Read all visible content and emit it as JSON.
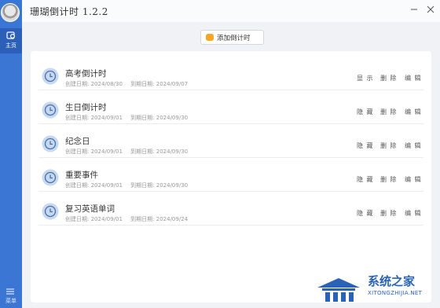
{
  "app": {
    "title": "珊瑚倒计时 1.2.2"
  },
  "sidebar": {
    "home_label": "主页",
    "menu_label": "菜单"
  },
  "toolbar": {
    "add_label": "添加倒计时"
  },
  "colors": {
    "sidebar": "#3b76d4",
    "accent": "#f5a623",
    "clock": "#c7d8f1"
  },
  "items": [
    {
      "name": "高考倒计时",
      "created": "创建日期: 2024/08/30",
      "due": "到期日期: 2024/09/07",
      "actions": [
        "显 示",
        "删 除",
        "编 辑"
      ]
    },
    {
      "name": "生日倒计时",
      "created": "创建日期: 2024/09/01",
      "due": "到期日期: 2024/09/30",
      "actions": [
        "隐 藏",
        "删 除",
        "编 辑"
      ]
    },
    {
      "name": "纪念日",
      "created": "创建日期: 2024/09/01",
      "due": "到期日期: 2024/09/30",
      "actions": [
        "隐 藏",
        "删 除",
        "编 辑"
      ]
    },
    {
      "name": "重要事件",
      "created": "创建日期: 2024/09/01",
      "due": "到期日期: 2024/09/30",
      "actions": [
        "隐 藏",
        "删 除",
        "编 辑"
      ]
    },
    {
      "name": "复习英语单词",
      "created": "创建日期: 2024/09/01",
      "due": "到期日期: 2024/09/24",
      "actions": [
        "隐 藏",
        "删 除",
        "编 辑"
      ]
    }
  ],
  "watermark": {
    "title": "系统之家",
    "url": "XITONGZHIJIA.NET"
  }
}
